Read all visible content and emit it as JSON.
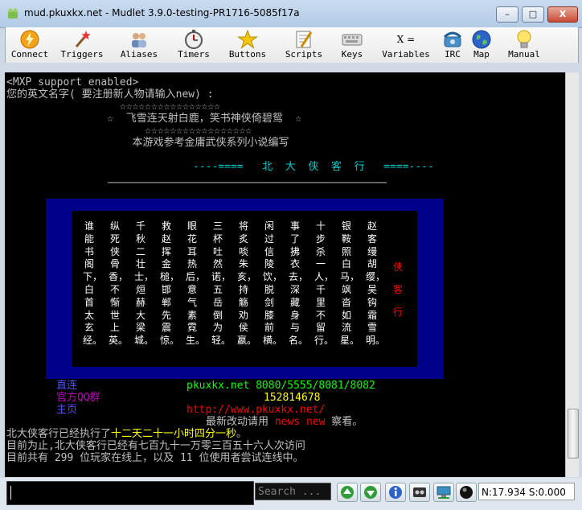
{
  "window": {
    "title": "mud.pkuxkx.net - Mudlet 3.9.0-testing-PR1716-5085f17a",
    "controls": [
      "–",
      "□",
      "X"
    ]
  },
  "toolbar": {
    "buttons": [
      {
        "label": "Connect",
        "icon": "lightning-icon"
      },
      {
        "label": "Triggers",
        "icon": "wand-icon"
      },
      {
        "label": "Aliases",
        "icon": "people-icon"
      },
      {
        "label": "Timers",
        "icon": "stopwatch-icon"
      },
      {
        "label": "Buttons",
        "icon": "star-icon"
      },
      {
        "label": "Scripts",
        "icon": "script-icon"
      },
      {
        "label": "Keys",
        "icon": "keyboard-icon"
      },
      {
        "label": "Variables",
        "icon": "variables-icon",
        "glyph": "X ="
      },
      {
        "label": "IRC",
        "icon": "phone-icon"
      },
      {
        "label": "Map",
        "icon": "globe-icon"
      },
      {
        "label": "Manual",
        "icon": "bulb-icon"
      }
    ]
  },
  "console": {
    "lines": [
      "<MXP support enabled>",
      "您的英文名字( 要注册新人物请输入new) :",
      "                  ☆☆☆☆☆☆☆☆☆☆☆☆☆☆☆☆",
      "                ☆  飞雪连天射白鹿，笑书神侠倚碧鸳  ☆",
      "                      ☆☆☆☆☆☆☆☆☆☆☆☆☆☆☆☆☆",
      "                    本游戏参考金庸武侠系列小说编写"
    ],
    "banner": "----====   北  大  侠  客  行   ====----",
    "divider": "────────────────────────────────────────────────",
    "poem_columns": [
      "谁能书阁下，白首太玄经。",
      "纵死侠骨香，不惭世上英。",
      "千秋二壮士，烜赫大梁城。",
      "救赵挥金槌，邯郸先震惊。",
      "眼花耳热后，意气素霓生。",
      "三杯吐然诺，五岳倒为轻。",
      "将炙啖朱亥，持觞劝侯嬴。",
      "闲过信陵饮，脱剑膝前横。",
      "事了拂衣去，深藏身与名。",
      "十步杀一人，千里不留行。",
      "银鞍照白马，飒沓如流星。",
      "赵客缦胡缨，吴钩霜雪明。"
    ],
    "poem_title": "侠客行",
    "info": {
      "direct_label": "直连",
      "qq_label": "官方QQ群",
      "home_label": "主页",
      "host": "pkuxkx.net 8080/5555/8081/8082",
      "qq": "152814678",
      "url": "http://www.pkuxkx.net/",
      "news_pre": "最新改动请用 ",
      "news_cmd": "news new",
      "news_post": " 察看。"
    },
    "uptime_pre": "北大侠客行已经执行了",
    "uptime": "十二天二十一小时四分一秒",
    "uptime_post": "。",
    "visits": "目前为止,北大侠客行已经有七百九十一万零三百五十六人次访问",
    "online": "目前共有 299 位玩家在线上，以及 11 位使用者尝试连线中。"
  },
  "bottom": {
    "search_placeholder": "Search ...",
    "status": "N:17.934 S:0.000"
  },
  "colors": {
    "console_bg": "#000000",
    "panel_bg": "#00008b",
    "banner": "#00cccc",
    "yellow": "#ffff00",
    "green": "#00ff00",
    "red": "#ff0000",
    "blue": "#5050ff",
    "magenta": "#c000c0"
  }
}
